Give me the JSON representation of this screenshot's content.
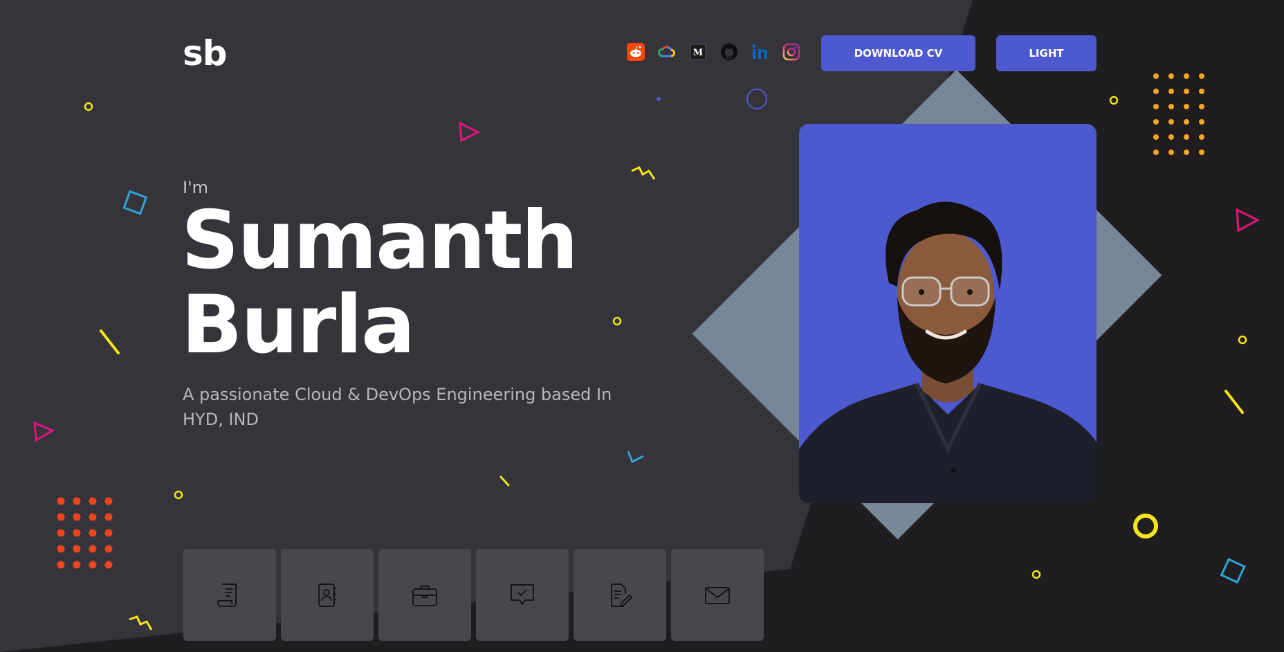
{
  "header": {
    "logo": "sb",
    "socials": [
      {
        "name": "reddit-icon",
        "color": "#ff4500"
      },
      {
        "name": "google-cloud-icon",
        "color": "#4285f4"
      },
      {
        "name": "medium-icon",
        "color": "#000000"
      },
      {
        "name": "github-icon",
        "color": "#000000"
      },
      {
        "name": "linkedin-icon",
        "color": "#0a66c2"
      },
      {
        "name": "instagram-icon",
        "color": "#e1306c"
      }
    ],
    "download_cv_label": "DOWNLOAD CV",
    "theme_toggle_label": "LIGHT"
  },
  "hero": {
    "intro": "I'm",
    "first_name": "Sumanth",
    "last_name": "Burla",
    "tagline": "A passionate Cloud & DevOps Engineering based In HYD, IND"
  },
  "nav_tiles": [
    {
      "name": "resume-icon"
    },
    {
      "name": "contacts-icon"
    },
    {
      "name": "briefcase-icon"
    },
    {
      "name": "testimonials-icon"
    },
    {
      "name": "blog-icon"
    },
    {
      "name": "mail-icon"
    }
  ],
  "colors": {
    "accent": "#4c59cf",
    "background_light": "#34343a",
    "background_dark": "#1f1d1f",
    "tile": "#47474d",
    "shape_yellow": "#f5e51b",
    "shape_pink": "#e0157a",
    "shape_blue": "#2fa4d9",
    "dots_orange": "#f5a623",
    "dots_red": "#f0441f"
  }
}
